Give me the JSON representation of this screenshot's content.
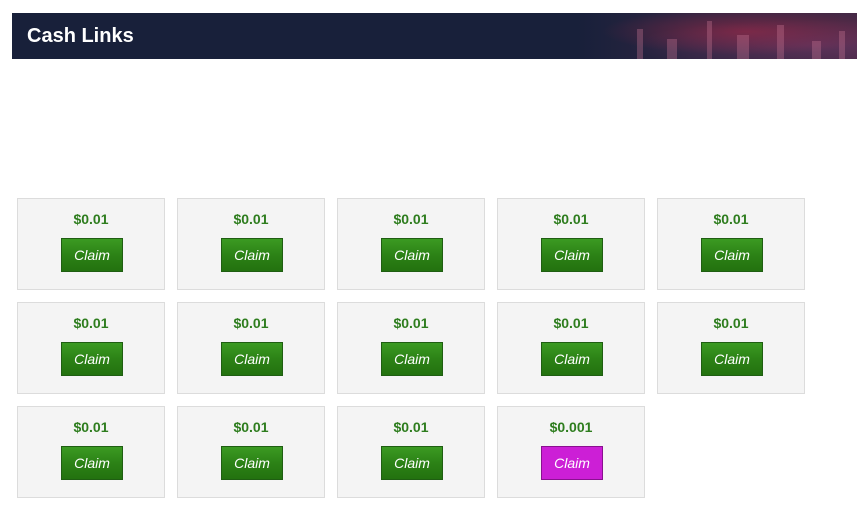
{
  "header": {
    "title": "Cash Links"
  },
  "colors": {
    "header_bg": "#18203a",
    "amount_text": "#2e7d1e",
    "claim_green": "#2c8216",
    "claim_magenta": "#cc1fd6"
  },
  "cards": [
    {
      "amount": "$0.01",
      "button": "Claim",
      "variant": "green"
    },
    {
      "amount": "$0.01",
      "button": "Claim",
      "variant": "green"
    },
    {
      "amount": "$0.01",
      "button": "Claim",
      "variant": "green"
    },
    {
      "amount": "$0.01",
      "button": "Claim",
      "variant": "green"
    },
    {
      "amount": "$0.01",
      "button": "Claim",
      "variant": "green"
    },
    {
      "amount": "$0.01",
      "button": "Claim",
      "variant": "green"
    },
    {
      "amount": "$0.01",
      "button": "Claim",
      "variant": "green"
    },
    {
      "amount": "$0.01",
      "button": "Claim",
      "variant": "green"
    },
    {
      "amount": "$0.01",
      "button": "Claim",
      "variant": "green"
    },
    {
      "amount": "$0.01",
      "button": "Claim",
      "variant": "green"
    },
    {
      "amount": "$0.01",
      "button": "Claim",
      "variant": "green"
    },
    {
      "amount": "$0.01",
      "button": "Claim",
      "variant": "green"
    },
    {
      "amount": "$0.01",
      "button": "Claim",
      "variant": "green"
    },
    {
      "amount": "$0.001",
      "button": "Claim",
      "variant": "magenta"
    }
  ]
}
